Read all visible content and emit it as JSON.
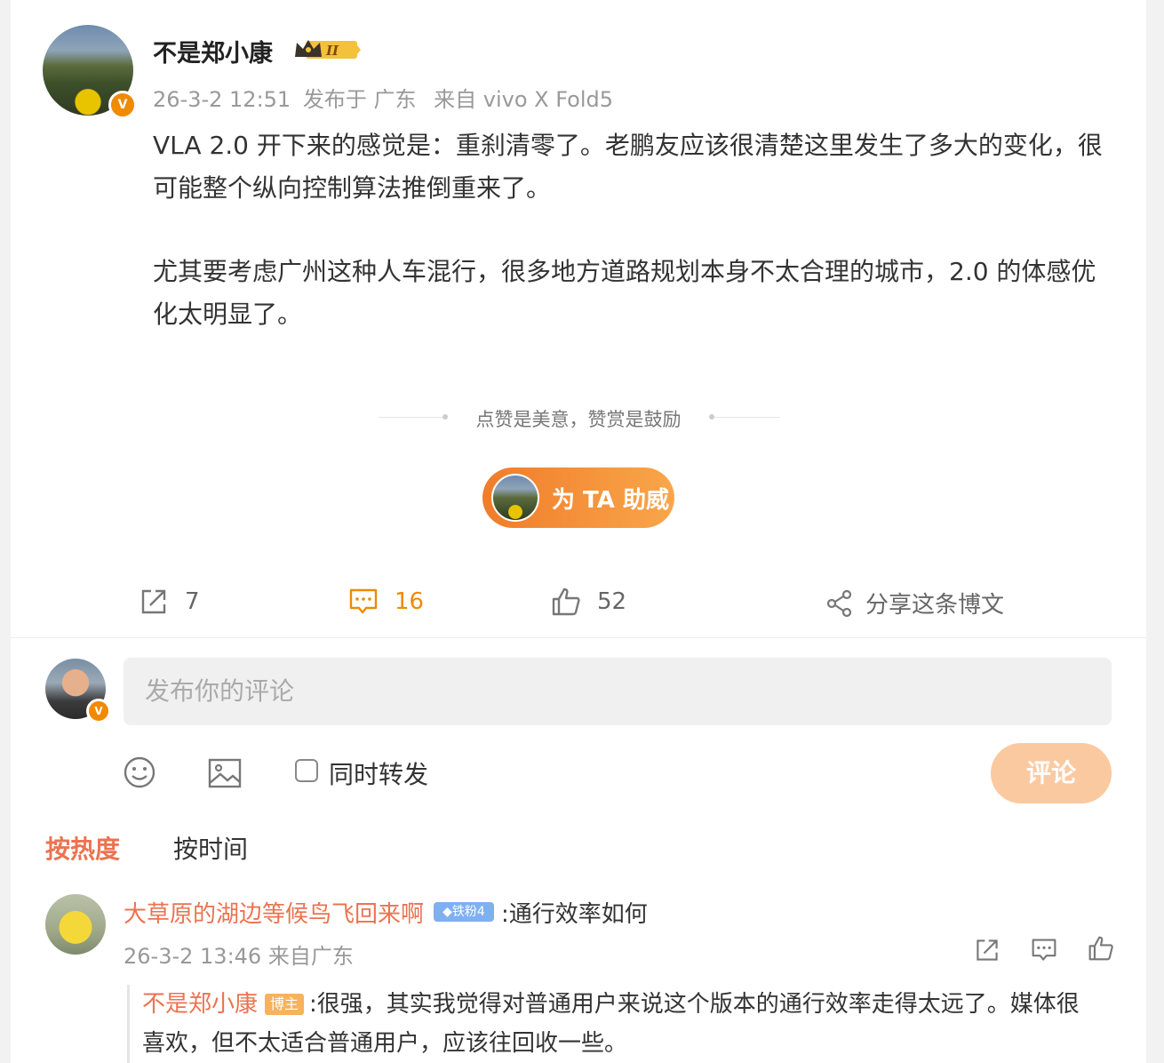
{
  "post": {
    "author": "不是郑小康",
    "level_badge": "II",
    "timestamp": "26-3-2 12:51",
    "location": "发布于 广东",
    "device": "来自 vivo X Fold5",
    "paragraphs": [
      "VLA 2.0 开下来的感觉是：重刹清零了。老鹏友应该很清楚这里发生了多大的变化，很可能整个纵向控制算法推倒重来了。",
      "尤其要考虑广州这种人车混行，很多地方道路规划本身不太合理的城市，2.0 的体感优化太明显了。"
    ],
    "reward_hint": "点赞是美意，赞赏是鼓励",
    "support_label": "为 TA 助威",
    "verified_badge": "V"
  },
  "actions": {
    "repost_count": "7",
    "comment_count": "16",
    "like_count": "52",
    "share_label": "分享这条博文"
  },
  "compose": {
    "placeholder": "发布你的评论",
    "forward_label": "同时转发",
    "submit_label": "评论"
  },
  "sort": {
    "hot": "按热度",
    "time": "按时间"
  },
  "comments": [
    {
      "user": "大草原的湖边等候鸟飞回来啊",
      "fan_badge": "铁粉4",
      "text": ":通行效率如何",
      "meta": "26-3-2 13:46 来自广东",
      "reply": {
        "user": "不是郑小康",
        "role": "博主",
        "text": ":很强，其实我觉得对普通用户来说这个版本的通行效率走得太远了。媒体很喜欢，但不太适合普通用户，应该往回收一些。"
      }
    }
  ],
  "colors": {
    "accent": "#eb7350",
    "orange": "#f08a00",
    "comment_active": "#f08a00"
  }
}
